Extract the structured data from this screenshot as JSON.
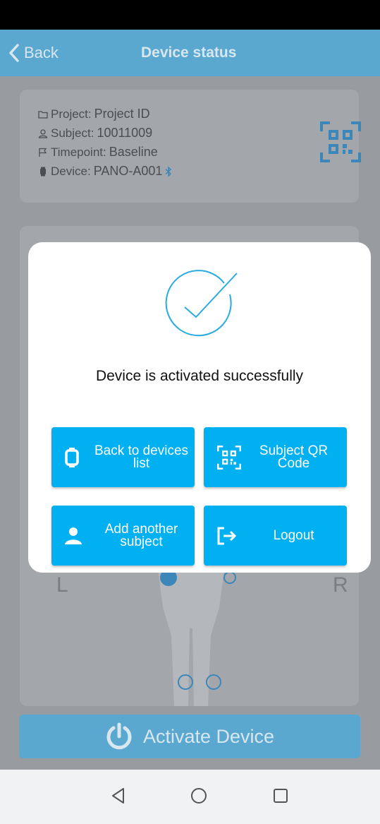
{
  "header": {
    "back_label": "Back",
    "title": "Device status"
  },
  "info": {
    "project_label": "Project:",
    "project_value": "Project ID",
    "subject_label": "Subject:",
    "subject_value": "10011009",
    "timepoint_label": "Timepoint:",
    "timepoint_value": "Baseline",
    "device_label": "Device:",
    "device_value": "PANO-A001"
  },
  "body_map": {
    "left_label": "L",
    "right_label": "R"
  },
  "activate": {
    "label": "Activate Device"
  },
  "modal": {
    "message": "Device is activated successfully",
    "buttons": {
      "back_to_list": "Back to devices list",
      "subject_qr": "Subject QR Code",
      "add_subject": "Add another subject",
      "logout": "Logout"
    }
  },
  "colors": {
    "accent": "#00b0f0",
    "header": "#5aa8cf",
    "check": "#29abe2"
  },
  "icons": {
    "back": "chevron-left-icon",
    "folder": "folder-icon",
    "person": "person-icon",
    "flag": "flag-icon",
    "watch": "watch-icon",
    "bluetooth": "bluetooth-icon",
    "qr": "qr-code-icon",
    "power": "power-icon",
    "logout": "logout-icon",
    "check": "check-circle-icon"
  }
}
